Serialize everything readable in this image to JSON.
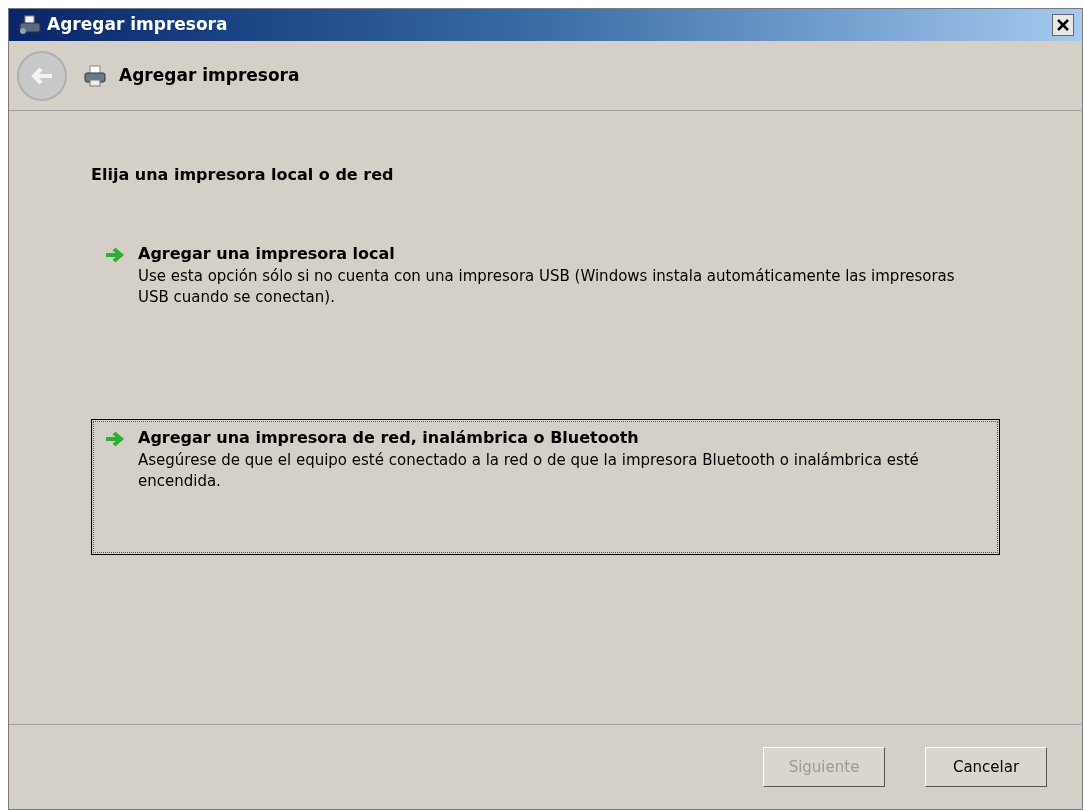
{
  "window": {
    "title": "Agregar impresora"
  },
  "header": {
    "title": "Agregar impresora",
    "back_disabled": true
  },
  "heading": "Elija una impresora local o de red",
  "options": [
    {
      "title": "Agregar una impresora local",
      "description": "Use esta opción sólo si no cuenta con una impresora USB (Windows instala automáticamente las impresoras USB cuando se conectan).",
      "selected": false
    },
    {
      "title": "Agregar una impresora de red, inalámbrica o Bluetooth",
      "description": "Asegúrese de que el equipo esté conectado a la red o de que la impresora Bluetooth o inalámbrica esté encendida.",
      "selected": true
    }
  ],
  "buttons": [
    {
      "label": "Siguiente",
      "disabled": true
    },
    {
      "label": "Cancelar",
      "disabled": false
    }
  ]
}
